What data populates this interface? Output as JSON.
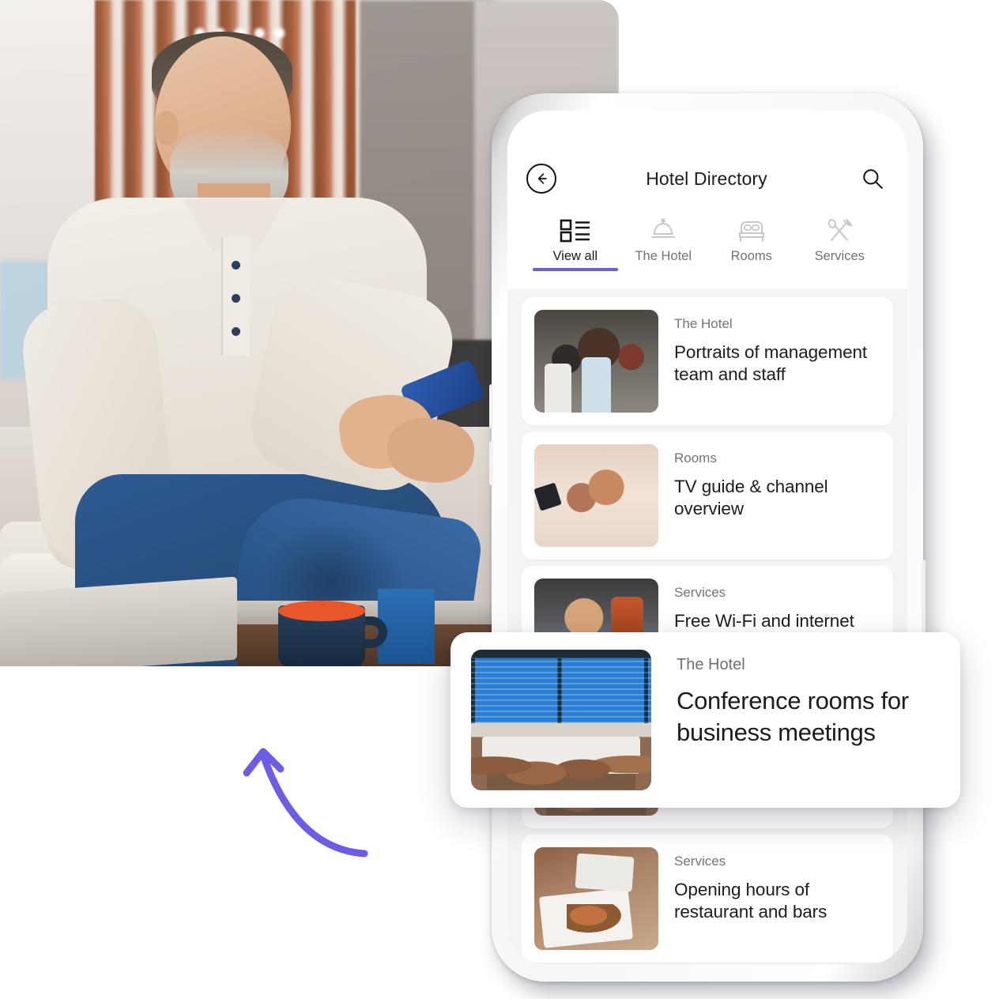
{
  "theme": {
    "accent": "#6c5ce7",
    "screen_bg": "#f4f4f6",
    "card_bg": "#ffffff",
    "title_color": "#1d1d1f",
    "muted_color": "#72747a"
  },
  "app": {
    "header": {
      "title": "Hotel Directory",
      "back_icon": "arrow-left-circle-icon",
      "search_icon": "search-icon"
    },
    "tabs": [
      {
        "label": "View all",
        "icon": "list-view-icon",
        "active": true
      },
      {
        "label": "The Hotel",
        "icon": "service-bell-icon",
        "active": false
      },
      {
        "label": "Rooms",
        "icon": "bed-icon",
        "active": false
      },
      {
        "label": "Services",
        "icon": "cutlery-icon",
        "active": false
      }
    ],
    "list": [
      {
        "category": "The Hotel",
        "title": "Portraits of management team and staff",
        "thumb": "hotel-staff-photo"
      },
      {
        "category": "Rooms",
        "title": "TV guide & channel overview",
        "thumb": "couple-watching-tv-photo"
      },
      {
        "category": "Services",
        "title": "Free Wi-Fi and internet access",
        "thumb": "man-with-laptop-photo"
      },
      {
        "category": "Services",
        "title": "Opening hours of restaurant and bars",
        "thumb": "restaurant-plates-photo"
      }
    ],
    "featured_card": {
      "category": "The Hotel",
      "title": "Conference rooms for business meetings",
      "thumb": "conference-room-photo"
    }
  },
  "hero": {
    "photo_alt": "smiling-bearded-man-on-sofa-using-smartphone"
  },
  "annotation": {
    "arrow": "curved-arrow-pointing-up-left",
    "arrow_color": "#6c5ce7"
  }
}
